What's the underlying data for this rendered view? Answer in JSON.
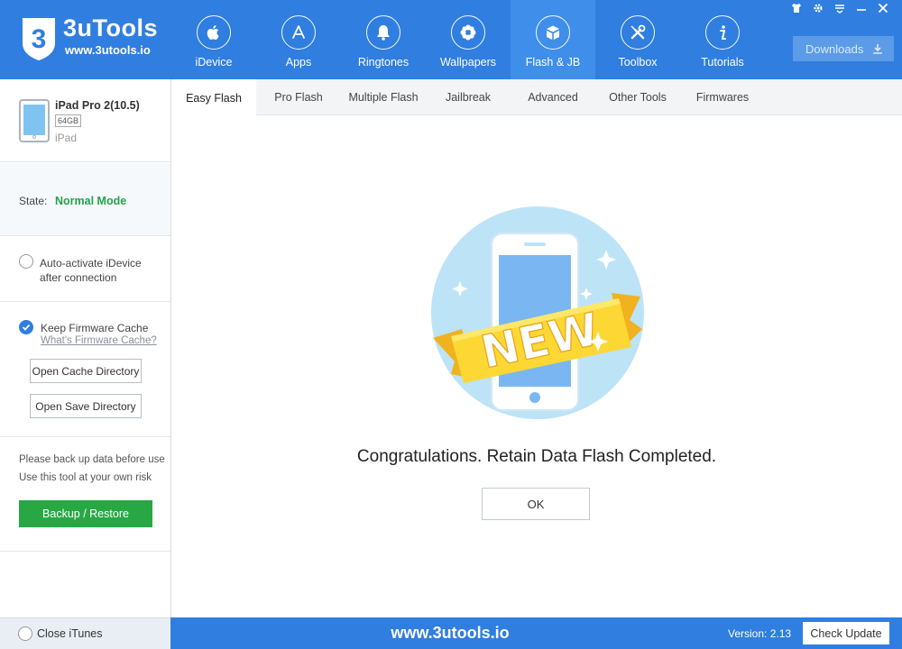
{
  "app": {
    "name": "3uTools",
    "url": "www.3utools.io",
    "logo_digit": "3",
    "brand_color": "#2f7ee0"
  },
  "nav": {
    "items": [
      {
        "label": "iDevice",
        "icon": "apple-icon"
      },
      {
        "label": "Apps",
        "icon": "appstore-icon"
      },
      {
        "label": "Ringtones",
        "icon": "bell-icon"
      },
      {
        "label": "Wallpapers",
        "icon": "flower-icon"
      },
      {
        "label": "Flash & JB",
        "icon": "box-icon",
        "active": true
      },
      {
        "label": "Toolbox",
        "icon": "tools-icon"
      },
      {
        "label": "Tutorials",
        "icon": "info-icon"
      }
    ],
    "downloads_label": "Downloads"
  },
  "window_controls": [
    "shirt-icon",
    "gear-icon",
    "menu-icon",
    "minimize-icon",
    "close-icon"
  ],
  "sidebar": {
    "device_name": "iPad Pro 2(10.5)",
    "capacity": "64GB",
    "device_type": "iPad",
    "state_label": "State:",
    "state_value": "Normal Mode",
    "auto_activate_line1": "Auto-activate iDevice",
    "auto_activate_line2": "after connection",
    "keep_cache_label": "Keep Firmware Cache",
    "cache_link": "What's Firmware Cache?",
    "open_cache_label": "Open Cache Directory",
    "open_save_label": "Open Save Directory",
    "warning_line1": "Please back up data before use",
    "warning_line2": "Use this tool at your own risk",
    "backup_label": "Backup / Restore",
    "state_color": "#23a24d",
    "backup_color": "#27a844"
  },
  "tabs": [
    {
      "label": "Easy Flash",
      "active": true
    },
    {
      "label": "Pro Flash"
    },
    {
      "label": "Multiple Flash"
    },
    {
      "label": "Jailbreak"
    },
    {
      "label": "Advanced"
    },
    {
      "label": "Other Tools"
    },
    {
      "label": "Firmwares"
    }
  ],
  "main": {
    "badge_text": "NEW",
    "message": "Congratulations. Retain Data Flash Completed.",
    "ok_label": "OK"
  },
  "footer": {
    "close_itunes_label": "Close iTunes",
    "url": "www.3utools.io",
    "version": "Version: 2.13",
    "check_update_label": "Check Update"
  }
}
